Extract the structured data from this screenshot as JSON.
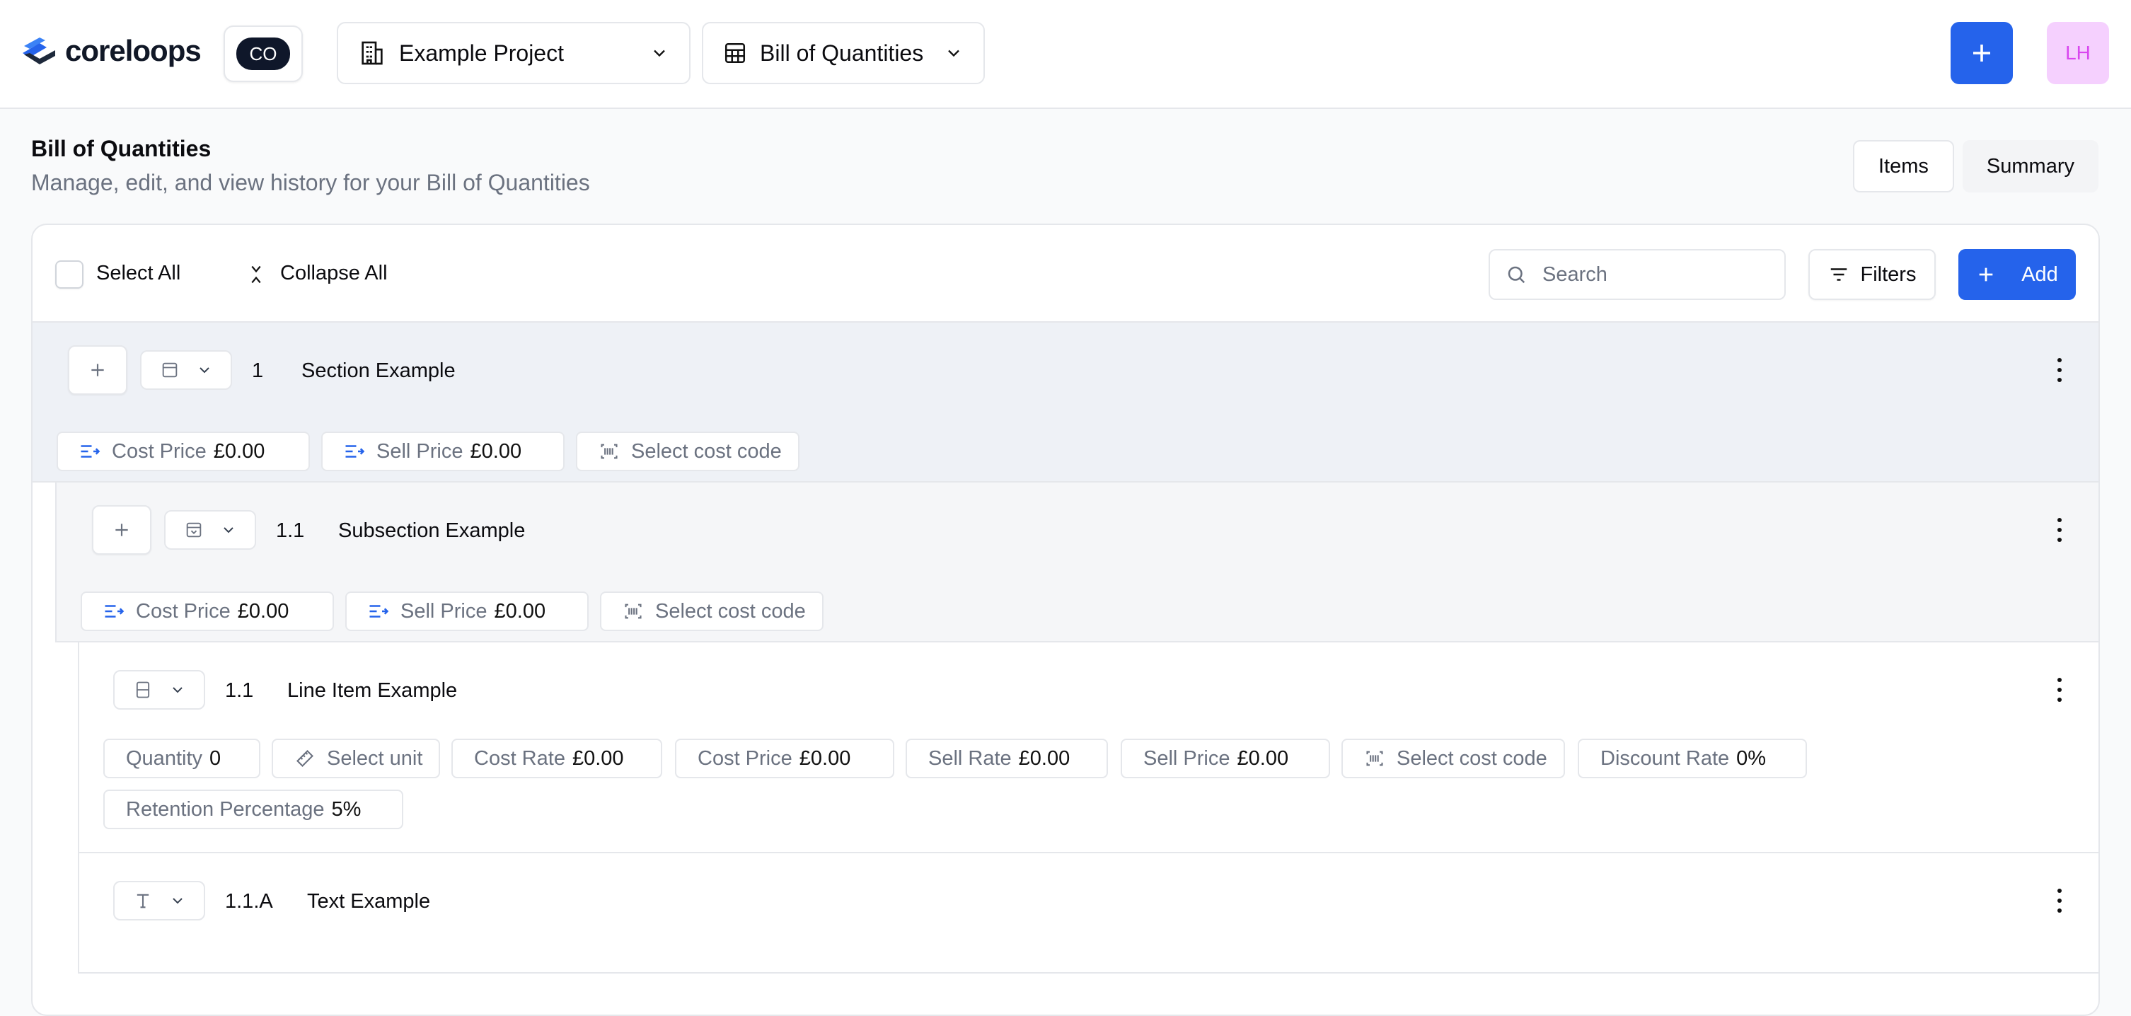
{
  "app": {
    "logo_text": "coreloops",
    "org_initials": "CO",
    "project": "Example Project",
    "module": "Bill of Quantities",
    "user_initials": "LH"
  },
  "page": {
    "title": "Bill of Quantities",
    "subtitle": "Manage, edit, and view history for your Bill of Quantities"
  },
  "view_tabs": {
    "items": "Items",
    "summary": "Summary"
  },
  "toolbar": {
    "select_all": "Select All",
    "collapse_all": "Collapse All",
    "search_placeholder": "Search",
    "filters": "Filters",
    "add": "Add"
  },
  "rows": {
    "section": {
      "number": "1",
      "title": "Section Example",
      "cost_price_label": "Cost Price",
      "cost_price": "£0.00",
      "sell_price_label": "Sell Price",
      "sell_price": "£0.00",
      "cost_code": "Select cost code"
    },
    "subsection": {
      "number": "1.1",
      "title": "Subsection Example",
      "cost_price_label": "Cost Price",
      "cost_price": "£0.00",
      "sell_price_label": "Sell Price",
      "sell_price": "£0.00",
      "cost_code": "Select cost code"
    },
    "line_item": {
      "number": "1.1",
      "title": "Line Item Example",
      "quantity_label": "Quantity",
      "quantity": "0",
      "unit": "Select unit",
      "cost_rate_label": "Cost Rate",
      "cost_rate": "£0.00",
      "cost_price_label": "Cost Price",
      "cost_price": "£0.00",
      "sell_rate_label": "Sell Rate",
      "sell_rate": "£0.00",
      "sell_price_label": "Sell Price",
      "sell_price": "£0.00",
      "cost_code": "Select cost code",
      "discount_label": "Discount Rate",
      "discount": "0%",
      "retention_label": "Retention Percentage",
      "retention": "5%"
    },
    "text_item": {
      "number": "1.1.A",
      "title": "Text Example"
    }
  },
  "colors": {
    "accent": "#2563eb",
    "avatar_bg": "#f5d0fe",
    "avatar_fg": "#d946ef",
    "section_bg": "#eef1f6"
  }
}
